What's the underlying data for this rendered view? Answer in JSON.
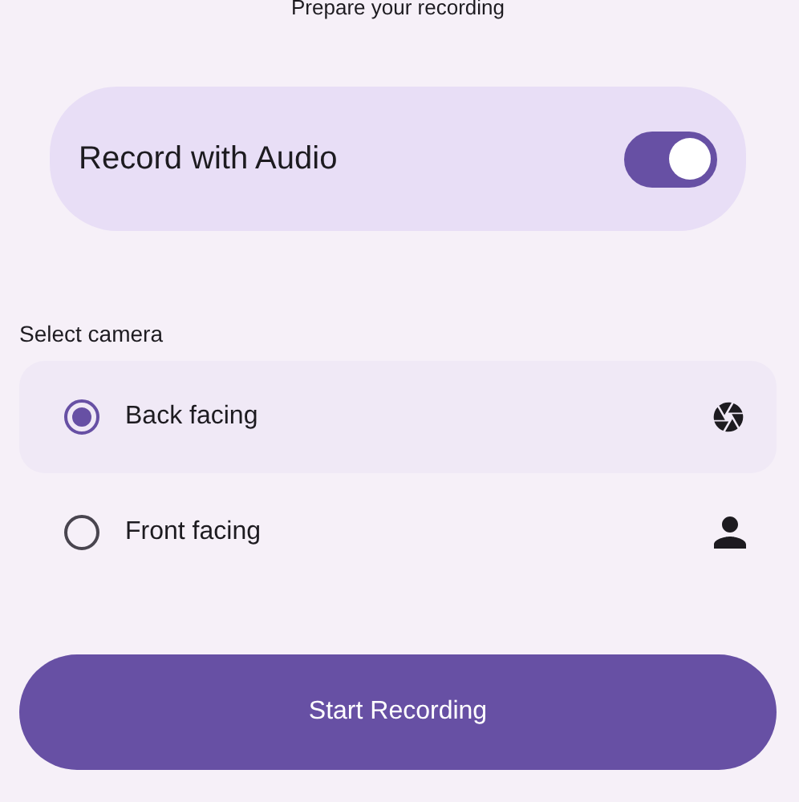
{
  "header": {
    "title": "Prepare your recording"
  },
  "audio": {
    "label": "Record with Audio",
    "on": true
  },
  "camera": {
    "heading": "Select camera",
    "options": [
      {
        "label": "Back facing",
        "selected": true,
        "kind": "back"
      },
      {
        "label": "Front facing",
        "selected": false,
        "kind": "front"
      }
    ]
  },
  "buttons": [
    {
      "label": "Start Recording"
    }
  ]
}
